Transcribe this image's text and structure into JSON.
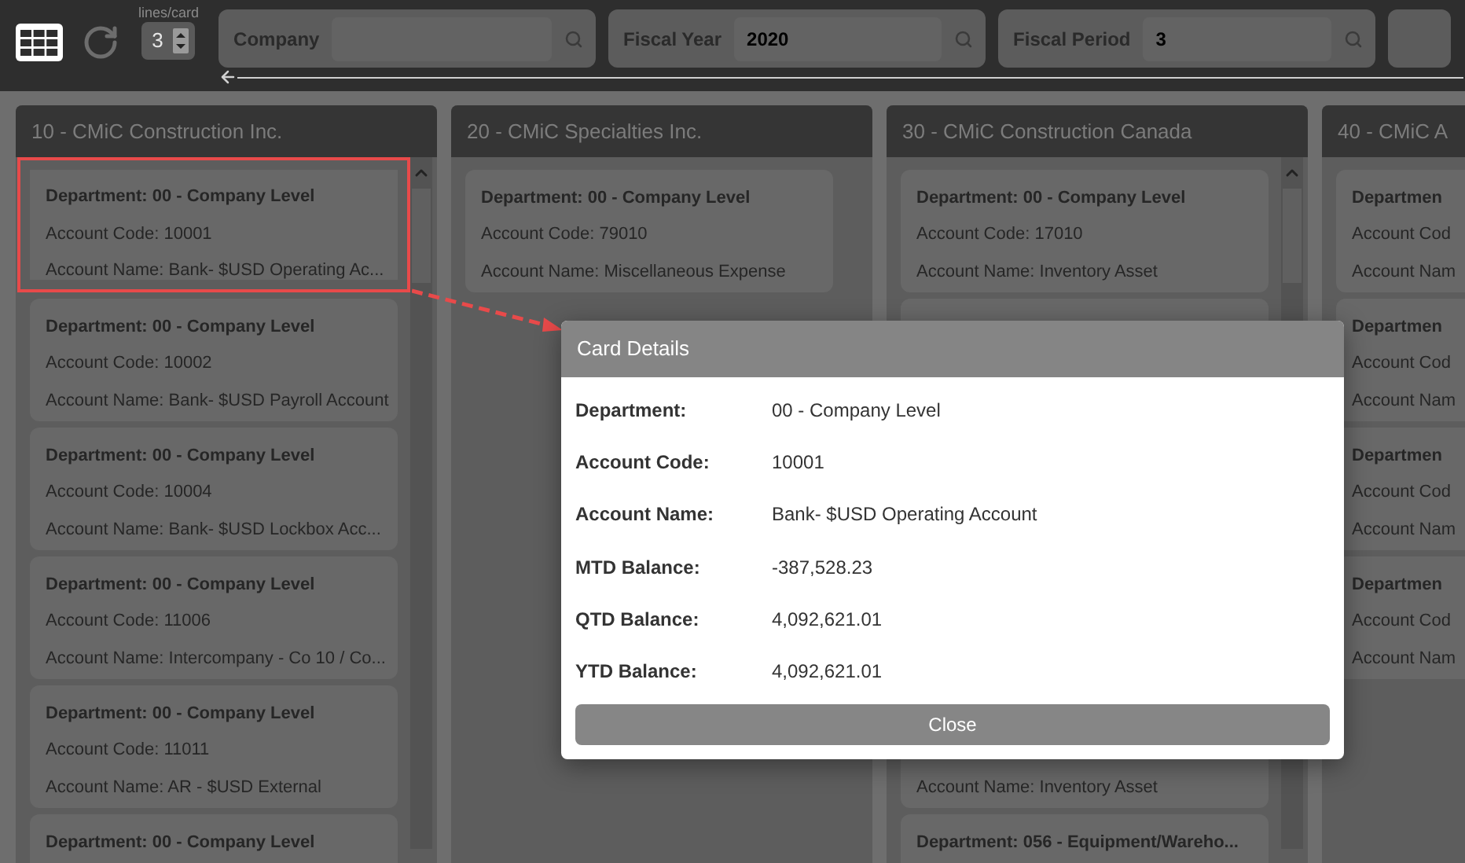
{
  "toolbar": {
    "lines_per_card": {
      "label": "lines/card",
      "value": "3"
    },
    "filters": [
      {
        "label": "Company"
      },
      {
        "label": "Fiscal Year",
        "value": "2020"
      },
      {
        "label": "Fiscal Period",
        "value": "3"
      }
    ]
  },
  "columns": [
    {
      "title": "10 - CMiC Construction Inc.",
      "scrollable": true,
      "cards": [
        {
          "department": "Department: 00 - Company Level",
          "account_code": "Account Code: 10001",
          "account_name": "Account Name: Bank- $USD Operating Ac...",
          "selected": true
        },
        {
          "department": "Department: 00 - Company Level",
          "account_code": "Account Code: 10002",
          "account_name": "Account Name: Bank- $USD Payroll Account",
          "selected": false
        },
        {
          "department": "Department: 00 - Company Level",
          "account_code": "Account Code: 10004",
          "account_name": "Account Name: Bank- $USD Lockbox Acc...",
          "selected": false
        },
        {
          "department": "Department: 00 - Company Level",
          "account_code": "Account Code: 11006",
          "account_name": "Account Name: Intercompany - Co 10 / Co...",
          "selected": false
        },
        {
          "department": "Department: 00 - Company Level",
          "account_code": "Account Code: 11011",
          "account_name": "Account Name: AR - $USD External",
          "selected": false
        },
        {
          "department": "Department: 00 - Company Level",
          "selected": false
        }
      ]
    },
    {
      "title": "20 - CMiC Specialties Inc.",
      "scrollable": false,
      "cards": [
        {
          "department": "Department: 00 - Company Level",
          "account_code": "Account Code: 79010",
          "account_name": "Account Name: Miscellaneous Expense",
          "selected": false
        }
      ]
    },
    {
      "title": "30 - CMiC Construction Canada",
      "scrollable": true,
      "cards": [
        {
          "department": "Department: 00 - Company Level",
          "account_code": "Account Code: 17010",
          "account_name": "Account Name: Inventory Asset",
          "selected": false
        },
        {
          "selected": false
        },
        {
          "account_name": "Account Name: Inventory Asset",
          "selected": false
        },
        {
          "department": "Department: 056 - Equipment/Wareho...",
          "selected": false
        }
      ]
    },
    {
      "title": "40 - CMiC A",
      "scrollable": false,
      "cards": [
        {
          "department": "Departmen",
          "account_code": "Account Cod",
          "account_name": "Account Nam",
          "selected": false
        },
        {
          "department": "Departmen",
          "account_code": "Account Cod",
          "account_name": "Account Nam",
          "selected": false
        },
        {
          "department": "Departmen",
          "account_code": "Account Cod",
          "account_name": "Account Nam",
          "selected": false
        },
        {
          "department": "Departmen",
          "account_code": "Account Cod",
          "account_name": "Account Nam",
          "selected": false
        }
      ]
    }
  ],
  "dialog": {
    "title": "Card Details",
    "fields": [
      {
        "label": "Department:",
        "value": "00 - Company Level"
      },
      {
        "label": "Account Code:",
        "value": "10001"
      },
      {
        "label": "Account Name:",
        "value": "Bank- $USD Operating Account"
      },
      {
        "label": "MTD Balance:",
        "value": "-387,528.23"
      },
      {
        "label": "QTD Balance:",
        "value": "4,092,621.01"
      },
      {
        "label": "YTD Balance:",
        "value": "4,092,621.01"
      }
    ],
    "button": "Close"
  }
}
